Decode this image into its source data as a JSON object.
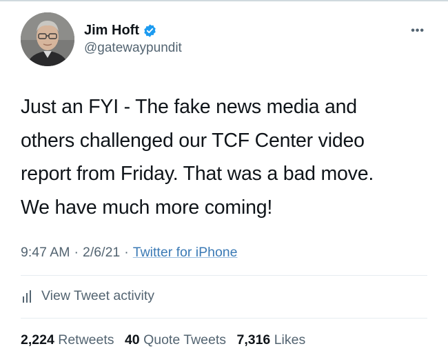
{
  "author": {
    "display_name": "Jim Hoft",
    "handle": "@gatewaypundit",
    "verified_icon": "verified-badge-icon",
    "avatar_icon": "avatar-photo"
  },
  "more_label": "•••",
  "tweet": {
    "text": "Just an FYI - The fake news media and\nothers challenged our TCF Center video\nreport from Friday. That was a bad move.\nWe have much more coming!"
  },
  "meta": {
    "time": "9:47 AM",
    "separator": "·",
    "date": "2/6/21",
    "source": "Twitter for iPhone"
  },
  "activity": {
    "label": "View Tweet activity",
    "icon": "bar-chart-icon"
  },
  "stats": {
    "retweets_count": "2,224",
    "retweets_label": "Retweets",
    "quotes_count": "40",
    "quotes_label": "Quote Tweets",
    "likes_count": "7,316",
    "likes_label": "Likes"
  },
  "colors": {
    "text": "#0f1419",
    "secondary": "#536471",
    "link": "#3b7ab5",
    "verified": "#1d9bf0",
    "divider": "#e6ecf0"
  }
}
